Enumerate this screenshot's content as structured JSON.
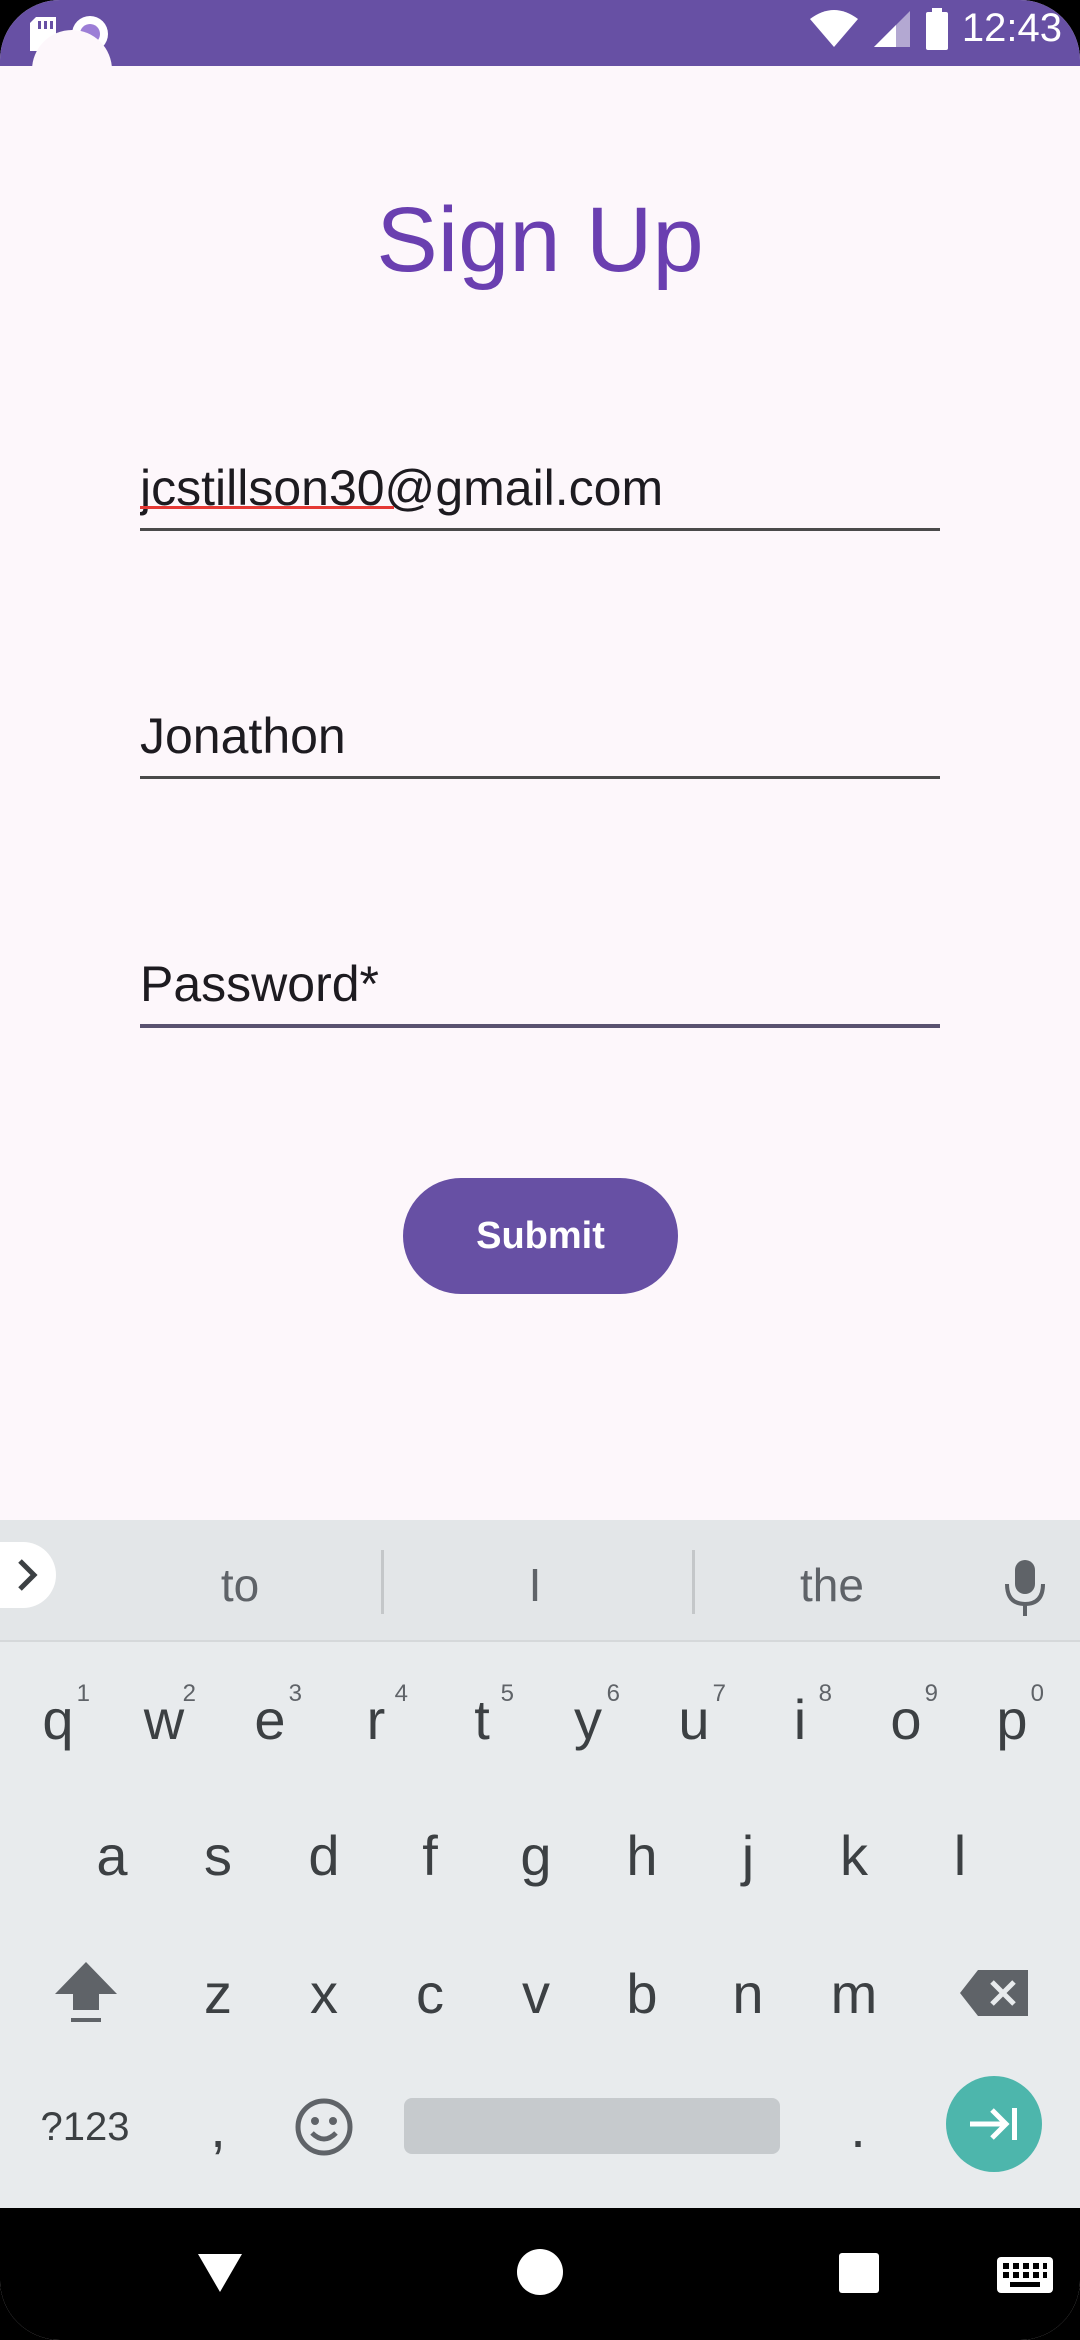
{
  "status_bar": {
    "time": "12:43",
    "icons": [
      "sd-card-icon",
      "circle-notification-icon",
      "wifi-icon",
      "cell-signal-icon",
      "battery-icon"
    ],
    "color": "#6750A4"
  },
  "form": {
    "title": "Sign Up",
    "email_value": "jcstillson30@gmail.com",
    "name_value": "Jonathon",
    "password_placeholder": "Password*",
    "submit_label": "Submit",
    "accent": "#6750A4"
  },
  "keyboard": {
    "suggestions": [
      "to",
      "I",
      "the"
    ],
    "row1": [
      {
        "k": "q",
        "h": "1"
      },
      {
        "k": "w",
        "h": "2"
      },
      {
        "k": "e",
        "h": "3"
      },
      {
        "k": "r",
        "h": "4"
      },
      {
        "k": "t",
        "h": "5"
      },
      {
        "k": "y",
        "h": "6"
      },
      {
        "k": "u",
        "h": "7"
      },
      {
        "k": "i",
        "h": "8"
      },
      {
        "k": "o",
        "h": "9"
      },
      {
        "k": "p",
        "h": "0"
      }
    ],
    "row2": [
      "a",
      "s",
      "d",
      "f",
      "g",
      "h",
      "j",
      "k",
      "l"
    ],
    "row3": [
      "z",
      "x",
      "c",
      "v",
      "b",
      "n",
      "m"
    ],
    "symbols_label": "?123",
    "comma_label": ",",
    "period_label": ".",
    "enter_color": "#4DB6AC"
  },
  "nav_bar": {
    "icons": [
      "back-icon",
      "home-icon",
      "recents-icon",
      "keyboard-switch-icon"
    ]
  }
}
